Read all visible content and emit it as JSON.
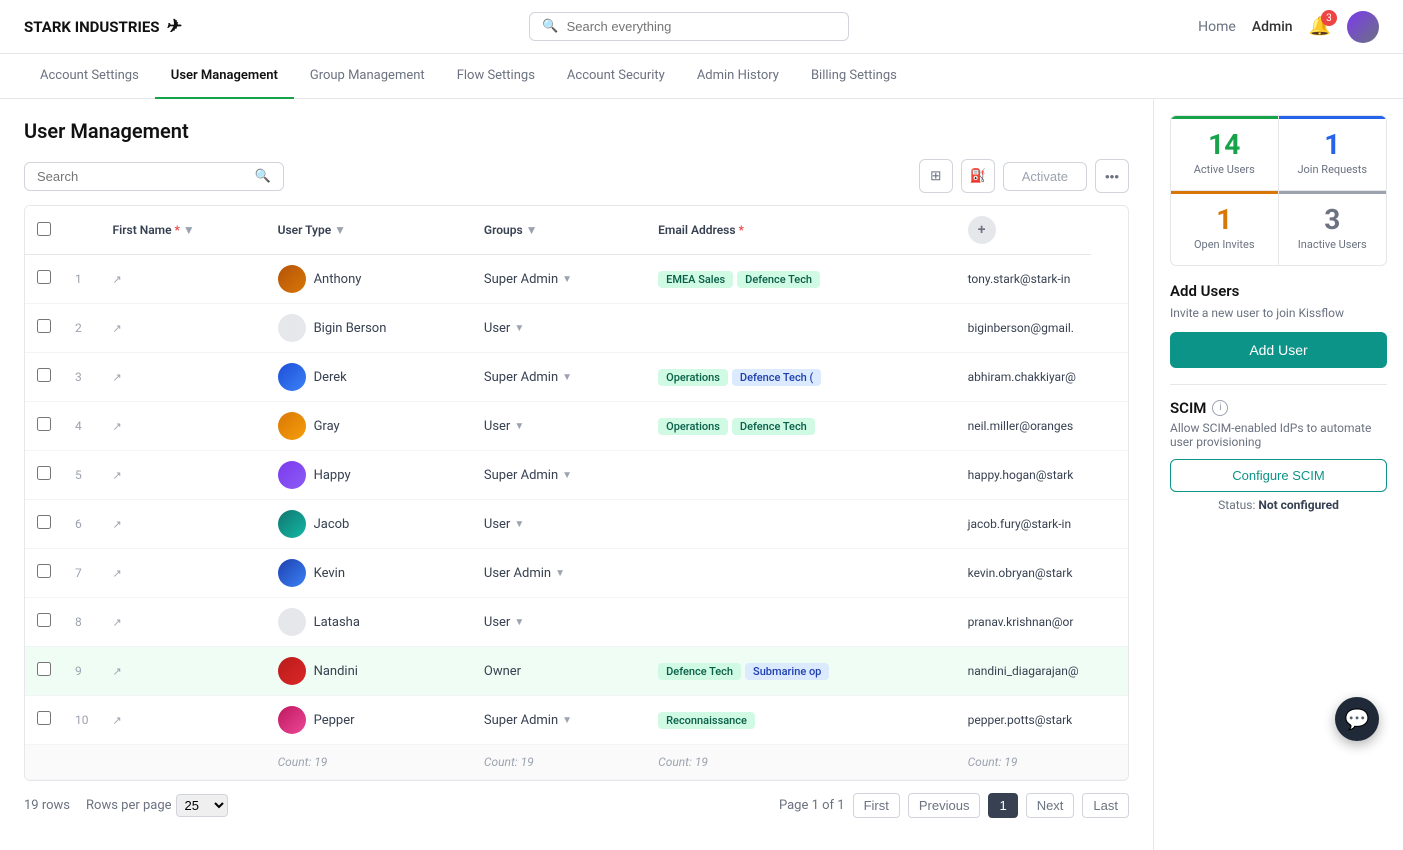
{
  "app": {
    "name": "STARK INDUSTRIES",
    "search_placeholder": "Search everything"
  },
  "nav": {
    "home": "Home",
    "admin": "Admin",
    "notifications_count": "3"
  },
  "tabs": [
    {
      "id": "account-settings",
      "label": "Account Settings"
    },
    {
      "id": "user-management",
      "label": "User Management",
      "active": true
    },
    {
      "id": "group-management",
      "label": "Group Management"
    },
    {
      "id": "flow-settings",
      "label": "Flow Settings"
    },
    {
      "id": "account-security",
      "label": "Account Security"
    },
    {
      "id": "admin-history",
      "label": "Admin History"
    },
    {
      "id": "billing-settings",
      "label": "Billing Settings"
    }
  ],
  "page": {
    "title": "User Management",
    "search_placeholder": "Search"
  },
  "toolbar": {
    "activate_label": "Activate",
    "more_label": "..."
  },
  "table": {
    "columns": [
      "",
      "",
      "First Name",
      "User Type",
      "Groups",
      "Email Address"
    ],
    "rows": [
      {
        "num": "1",
        "name": "Anthony",
        "type": "Super Admin",
        "groups": [
          "EMEA Sales",
          "Defence Tech"
        ],
        "email": "tony.stark@stark-in",
        "avatar_class": "ua-1"
      },
      {
        "num": "2",
        "name": "Bigin Berson",
        "type": "User",
        "groups": [],
        "email": "biginberson@gmail.",
        "avatar_class": "ua-2"
      },
      {
        "num": "3",
        "name": "Derek",
        "type": "Super Admin",
        "groups": [
          "Operations",
          "Defence Tech ("
        ],
        "email": "abhiram.chakkiyar@",
        "avatar_class": "ua-3"
      },
      {
        "num": "4",
        "name": "Gray",
        "type": "User",
        "groups": [
          "Operations",
          "Defence Tech"
        ],
        "email": "neil.miller@oranges",
        "avatar_class": "ua-4"
      },
      {
        "num": "5",
        "name": "Happy",
        "type": "Super Admin",
        "groups": [],
        "email": "happy.hogan@stark",
        "avatar_class": "ua-5"
      },
      {
        "num": "6",
        "name": "Jacob",
        "type": "User",
        "groups": [],
        "email": "jacob.fury@stark-in",
        "avatar_class": "ua-6"
      },
      {
        "num": "7",
        "name": "Kevin",
        "type": "User Admin",
        "groups": [],
        "email": "kevin.obryan@stark",
        "avatar_class": "ua-7"
      },
      {
        "num": "8",
        "name": "Latasha",
        "type": "User",
        "groups": [],
        "email": "pranav.krishnan@or",
        "avatar_class": "ua-8"
      },
      {
        "num": "9",
        "name": "Nandini",
        "type": "Owner",
        "groups": [
          "Defence Tech",
          "Submarine op"
        ],
        "email": "nandini_diagarajan@",
        "avatar_class": "ua-9"
      },
      {
        "num": "10",
        "name": "Pepper",
        "type": "Super Admin",
        "groups": [
          "Reconnaissance"
        ],
        "email": "pepper.potts@stark",
        "avatar_class": "ua-10"
      }
    ],
    "count_row": {
      "first_name": "Count: 19",
      "user_type": "Count: 19",
      "groups": "Count: 19",
      "email": "Count: 19"
    }
  },
  "pagination": {
    "rows_info": "19 rows",
    "rows_per_page_label": "Rows per page",
    "rows_per_page_value": "25",
    "page_info": "Page 1 of 1",
    "first": "First",
    "previous": "Previous",
    "current": "1",
    "next": "Next",
    "last": "Last"
  },
  "sidebar": {
    "stats": [
      {
        "num": "14",
        "label": "Active Users",
        "color": "green"
      },
      {
        "num": "1",
        "label": "Join Requests",
        "color": "blue"
      },
      {
        "num": "1",
        "label": "Open Invites",
        "color": "yellow"
      },
      {
        "num": "3",
        "label": "Inactive Users",
        "color": "gray"
      }
    ],
    "add_users": {
      "title": "Add Users",
      "description": "Invite a new user to join Kissflow",
      "button": "Add User"
    },
    "scim": {
      "title": "SCIM",
      "description": "Allow SCIM-enabled IdPs to automate user provisioning",
      "button": "Configure SCIM",
      "status_label": "Status:",
      "status_value": "Not configured"
    }
  }
}
